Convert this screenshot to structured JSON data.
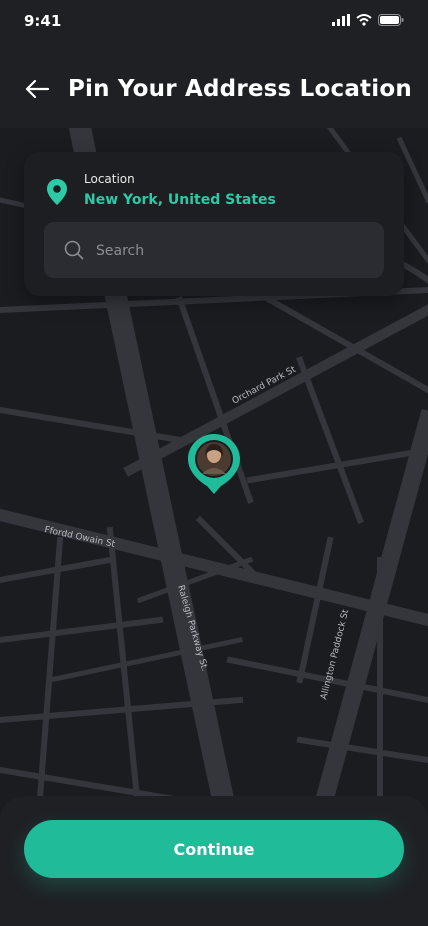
{
  "status_bar": {
    "time": "9:41"
  },
  "header": {
    "title": "Pin Your Address Location"
  },
  "location_card": {
    "label": "Location",
    "value": "New York, United States",
    "search_placeholder": "Search"
  },
  "map": {
    "streets": [
      "Orchard Park St",
      "Ffordd Owain St",
      "Raleigh Parkway St.",
      "Allington Paddock St"
    ]
  },
  "continue_label": "Continue",
  "colors": {
    "accent": "#20bb99",
    "background": "#1f2024",
    "map_block": "#1b1c20",
    "road": "#34363c"
  },
  "icons": [
    "back-arrow-icon",
    "location-pin-icon",
    "search-icon",
    "signal-icon",
    "wifi-icon",
    "battery-icon",
    "avatar-pin-icon"
  ]
}
